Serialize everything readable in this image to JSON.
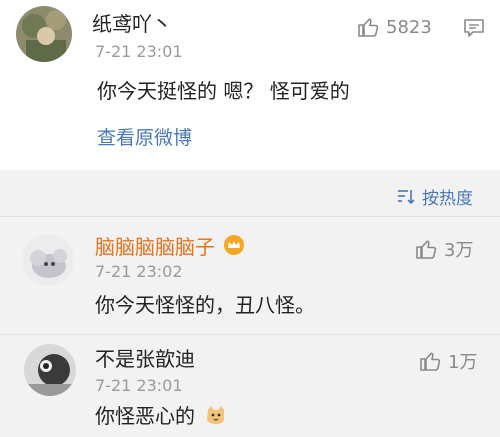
{
  "post": {
    "username": "纸鸢吖丶",
    "time": "7-21 23:01",
    "likes": "5823",
    "text": "你今天挺怪的 嗯？ 怪可爱的",
    "view_original_label": "查看原微博"
  },
  "sort": {
    "label": "按热度"
  },
  "comments": [
    {
      "username": "脑脑脑脑脑子",
      "time": "7-21 23:02",
      "likes": "3万",
      "text": "你今天怪怪的，丑八怪。"
    },
    {
      "username": "不是张歆迪",
      "time": "7-21 23:01",
      "likes": "1万",
      "text": "你怪恶心的"
    }
  ],
  "colors": {
    "accent_blue": "#4a78b6",
    "vip_orange": "#e8711c",
    "meta_gray": "#9a9a9a"
  },
  "icons": [
    "thumbs-up-icon",
    "comment-icon",
    "sort-icon",
    "crown-badge-icon",
    "cat-emoji-icon"
  ]
}
